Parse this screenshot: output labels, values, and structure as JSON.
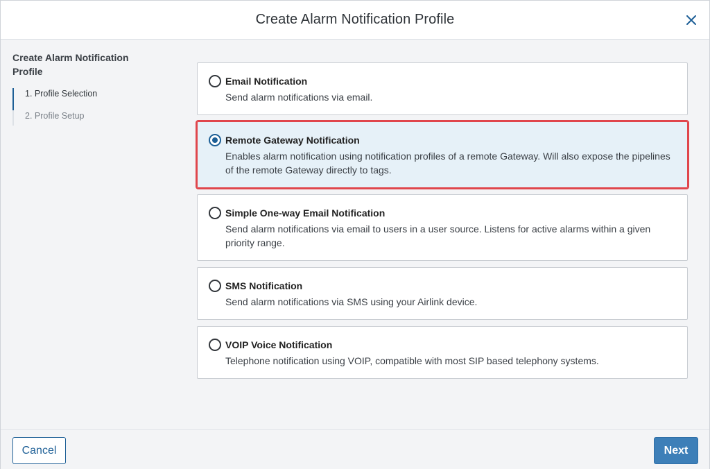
{
  "dialog": {
    "title": "Create Alarm Notification Profile"
  },
  "sidebar": {
    "title": "Create Alarm Notification Profile",
    "steps": [
      {
        "label": "1. Profile Selection",
        "active": true
      },
      {
        "label": "2. Profile Setup",
        "active": false
      }
    ]
  },
  "options": [
    {
      "title": "Email Notification",
      "description": "Send alarm notifications via email.",
      "selected": false
    },
    {
      "title": "Remote Gateway Notification",
      "description": "Enables alarm notification using notification profiles of a remote Gateway. Will also expose the pipelines of the remote Gateway directly to tags.",
      "selected": true
    },
    {
      "title": "Simple One-way Email Notification",
      "description": "Send alarm notifications via email to users in a user source. Listens for active alarms within a given priority range.",
      "selected": false
    },
    {
      "title": "SMS Notification",
      "description": "Send alarm notifications via SMS using your Airlink device.",
      "selected": false
    },
    {
      "title": "VOIP Voice Notification",
      "description": "Telephone notification using VOIP, compatible with most SIP based telephony systems.",
      "selected": false
    }
  ],
  "footer": {
    "cancel_label": "Cancel",
    "next_label": "Next"
  },
  "colors": {
    "accent": "#1d5f96",
    "primary_button": "#3d7fb8",
    "selected_bg": "#e6f1f8",
    "highlight_outline": "#e0464c"
  },
  "icons": {
    "close": "close-icon"
  }
}
